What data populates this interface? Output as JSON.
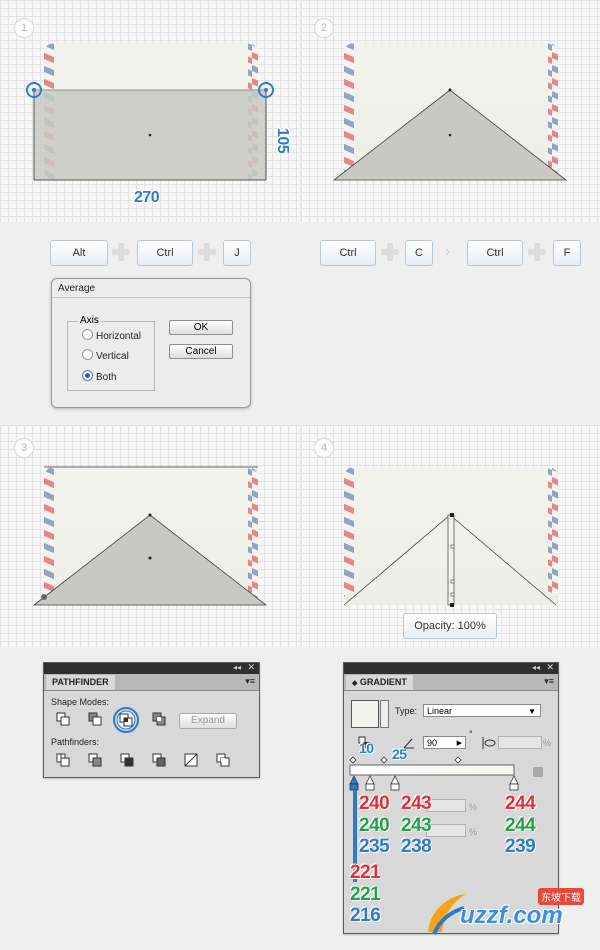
{
  "steps": [
    "1",
    "2",
    "3",
    "4"
  ],
  "step1": {
    "width_label": "270",
    "height_label": "105"
  },
  "shortcuts_left": [
    "Alt",
    "Ctrl",
    "J"
  ],
  "shortcuts_right": [
    "Ctrl",
    "C",
    "Ctrl",
    "F"
  ],
  "average_dialog": {
    "title": "Average",
    "axis_legend": "Axis",
    "options": [
      "Horizontal",
      "Vertical",
      "Both"
    ],
    "selected": "Both",
    "ok_label": "OK",
    "cancel_label": "Cancel"
  },
  "step4": {
    "opacity_label": "Opacity: 100%"
  },
  "pathfinder": {
    "tab": "PATHFINDER",
    "shape_modes_label": "Shape Modes:",
    "expand_label": "Expand",
    "pathfinders_label": "Pathfinders:"
  },
  "gradient": {
    "tab": "GRADIENT",
    "type_label": "Type:",
    "type_value": "Linear",
    "angle_value": "90",
    "degree_symbol": "°",
    "percent": "%",
    "stop_positions": [
      "10",
      "25"
    ],
    "colors": {
      "c1": {
        "r": "240",
        "g": "240",
        "b": "235"
      },
      "c2": {
        "r": "243",
        "g": "243",
        "b": "238"
      },
      "c3": {
        "r": "244",
        "g": "244",
        "b": "239"
      },
      "c4": {
        "r": "221",
        "g": "221",
        "b": "216"
      }
    }
  },
  "watermark": {
    "text": "uzzf.com",
    "tag": "东坡下载"
  },
  "accent_colors": {
    "highlight_blue": "#2f7bc8",
    "stripe_red": "#e27e84",
    "stripe_blue": "#8aa3bd"
  }
}
